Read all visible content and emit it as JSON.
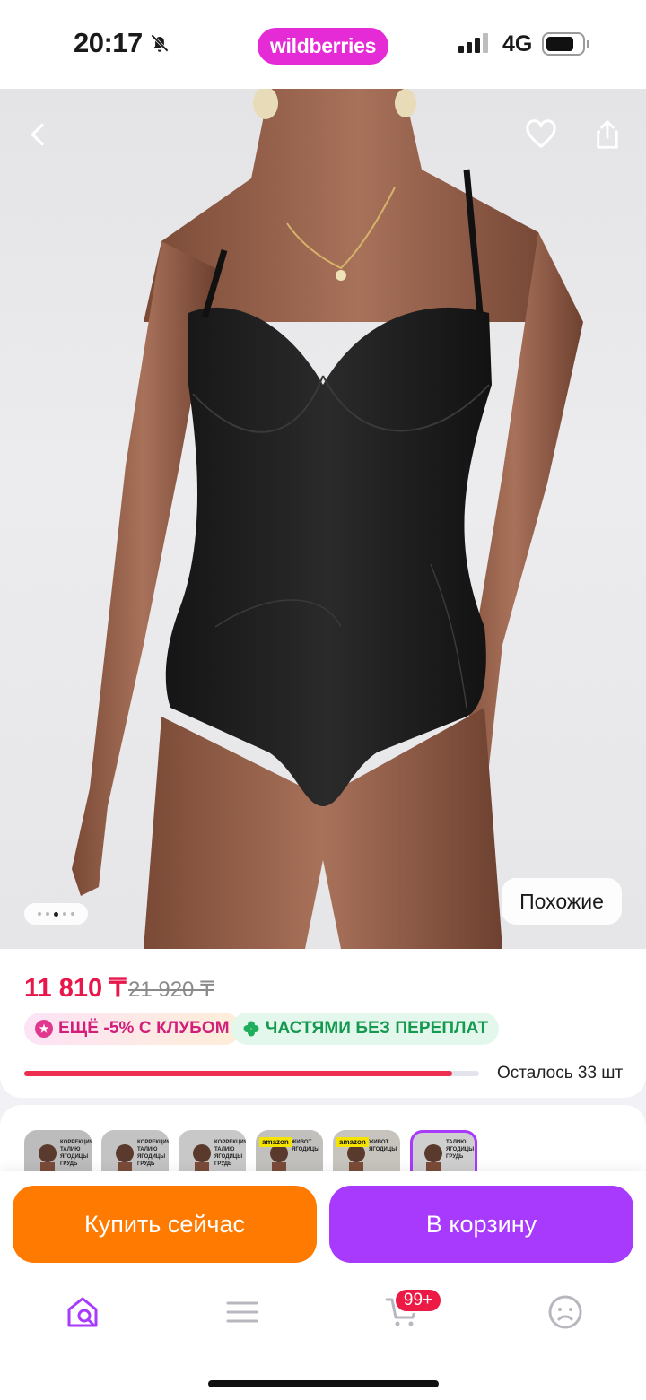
{
  "status_bar": {
    "time": "20:17",
    "brand": "wildberries",
    "network": "4G",
    "icons": [
      "bell-slash-icon",
      "signal-icon",
      "battery-icon"
    ]
  },
  "product": {
    "image_alt": "Black shapewear bodysuit worn by model",
    "gallery": {
      "count": 5,
      "active_index": 2
    },
    "similar_label": "Похожие",
    "price": "11 810 ₸",
    "old_price": "21 920 ₸",
    "badges": [
      {
        "label": "ЕЩЁ -5% С КЛУБОМ",
        "icon": "club-star-icon"
      },
      {
        "label": "ЧАСТЯМИ БЕЗ ПЕРЕПЛАТ",
        "icon": "clover-icon"
      }
    ],
    "stock_text": "Осталось 33 шт",
    "stock_fraction": 0.94
  },
  "thumbnails": [
    {
      "caption": "КОРРЕКЦИЯ! ТАЛИЮ ЯГОДИЦЫ ГРУДЬ",
      "promo": ""
    },
    {
      "caption": "КОРРЕКЦИЯ! ТАЛИЮ ЯГОДИЦЫ ГРУДЬ",
      "promo": ""
    },
    {
      "caption": "КОРРЕКЦИЯ! ТАЛИЮ ЯГОДИЦЫ ГРУДЬ",
      "promo": ""
    },
    {
      "caption": "ЖИВОТ ЯГОДИЦЫ",
      "promo": "amazon"
    },
    {
      "caption": "ЖИВОТ ЯГОДИЦЫ",
      "promo": "amazon"
    },
    {
      "caption": "ТАЛИЮ ЯГОДИЦЫ ГРУДЬ",
      "promo": ""
    }
  ],
  "actions": {
    "buy_now": "Купить сейчас",
    "add_to_cart": "В корзину"
  },
  "tabbar": {
    "items": [
      "home-search-icon",
      "catalog-menu-icon",
      "cart-icon",
      "profile-icon"
    ],
    "active": 0,
    "cart_badge": "99+"
  },
  "colors": {
    "brand": "#e52bd6",
    "price": "#e8164b",
    "buy": "#ff7a00",
    "cart": "#a73afd",
    "active_tab": "#a73afd"
  }
}
